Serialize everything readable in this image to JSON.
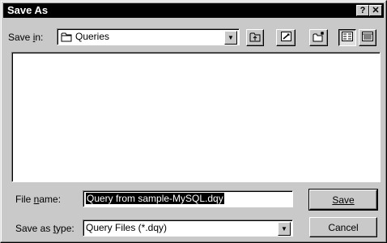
{
  "window": {
    "title": "Save As",
    "help_glyph": "?",
    "close_glyph": "✕"
  },
  "save_in": {
    "label_before": "Save ",
    "label_accel": "i",
    "label_after": "n:",
    "value": "Queries",
    "icon": "folder-icon"
  },
  "toolbar": {
    "buttons": [
      "up-one-level-icon",
      "desktop-icon",
      "create-new-folder-icon",
      "list-view-icon",
      "details-view-icon"
    ]
  },
  "file_name": {
    "label_before": "File ",
    "label_accel": "n",
    "label_after": "ame:",
    "value": "Query from sample-MySQL.dqy"
  },
  "save_as_type": {
    "label_before": "Save as ",
    "label_accel": "t",
    "label_after": "ype:",
    "value": "Query Files (*.dqy)"
  },
  "buttons": {
    "save": "Save",
    "cancel": "Cancel"
  }
}
